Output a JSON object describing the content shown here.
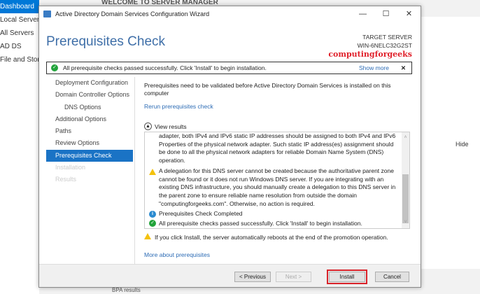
{
  "background": {
    "sidebar": [
      "Dashboard",
      "Local Server",
      "All Servers",
      "AD DS",
      "File and Storage Services"
    ],
    "welcome": "WELCOME TO SERVER MANAGER",
    "hide": "Hide",
    "bpa": "BPA results"
  },
  "window": {
    "title": "Active Directory Domain Services Configuration Wizard",
    "minimize": "—",
    "maximize": "☐",
    "close": "✕"
  },
  "page_title": "Prerequisites Check",
  "target": {
    "label": "TARGET SERVER",
    "server": "WIN-6NELC32G2ST"
  },
  "watermark": "computingforgeeks",
  "banner": {
    "text": "All prerequisite checks passed successfully.  Click 'Install' to begin installation.",
    "show_more": "Show more",
    "dismiss": "✕"
  },
  "nav": [
    {
      "label": "Deployment Configuration"
    },
    {
      "label": "Domain Controller Options"
    },
    {
      "label": "DNS Options"
    },
    {
      "label": "Additional Options"
    },
    {
      "label": "Paths"
    },
    {
      "label": "Review Options"
    },
    {
      "label": "Prerequisites Check"
    },
    {
      "label": "Installation"
    },
    {
      "label": "Results"
    }
  ],
  "content": {
    "intro": "Prerequisites need to be validated before Active Directory Domain Services is installed on this computer",
    "rerun": "Rerun prerequisites check",
    "view_results": "View results",
    "results": [
      {
        "icon": "none",
        "text": "adapter, both IPv4 and IPv6 static IP addresses should be assigned to both IPv4 and IPv6 Properties of the physical network adapter. Such static IP address(es) assignment should be done to all the physical network adapters for reliable Domain Name System (DNS) operation."
      },
      {
        "icon": "warning",
        "text": "A delegation for this DNS server cannot be created because the authoritative parent zone cannot be found or it does not run Windows DNS server. If you are integrating with an existing DNS infrastructure, you should manually create a delegation to this DNS server in the parent zone to ensure reliable name resolution from outside the domain \"computingforgeeks.com\". Otherwise, no action is required."
      },
      {
        "icon": "info",
        "text": "Prerequisites Check Completed"
      },
      {
        "icon": "success",
        "text": "All prerequisite checks passed successfully.  Click 'Install' to begin installation."
      }
    ],
    "reboot_warning": "If you click Install, the server automatically reboots at the end of the promotion operation.",
    "more_link": "More about prerequisites"
  },
  "buttons": {
    "previous": "< Previous",
    "next": "Next >",
    "install": "Install",
    "cancel": "Cancel"
  }
}
